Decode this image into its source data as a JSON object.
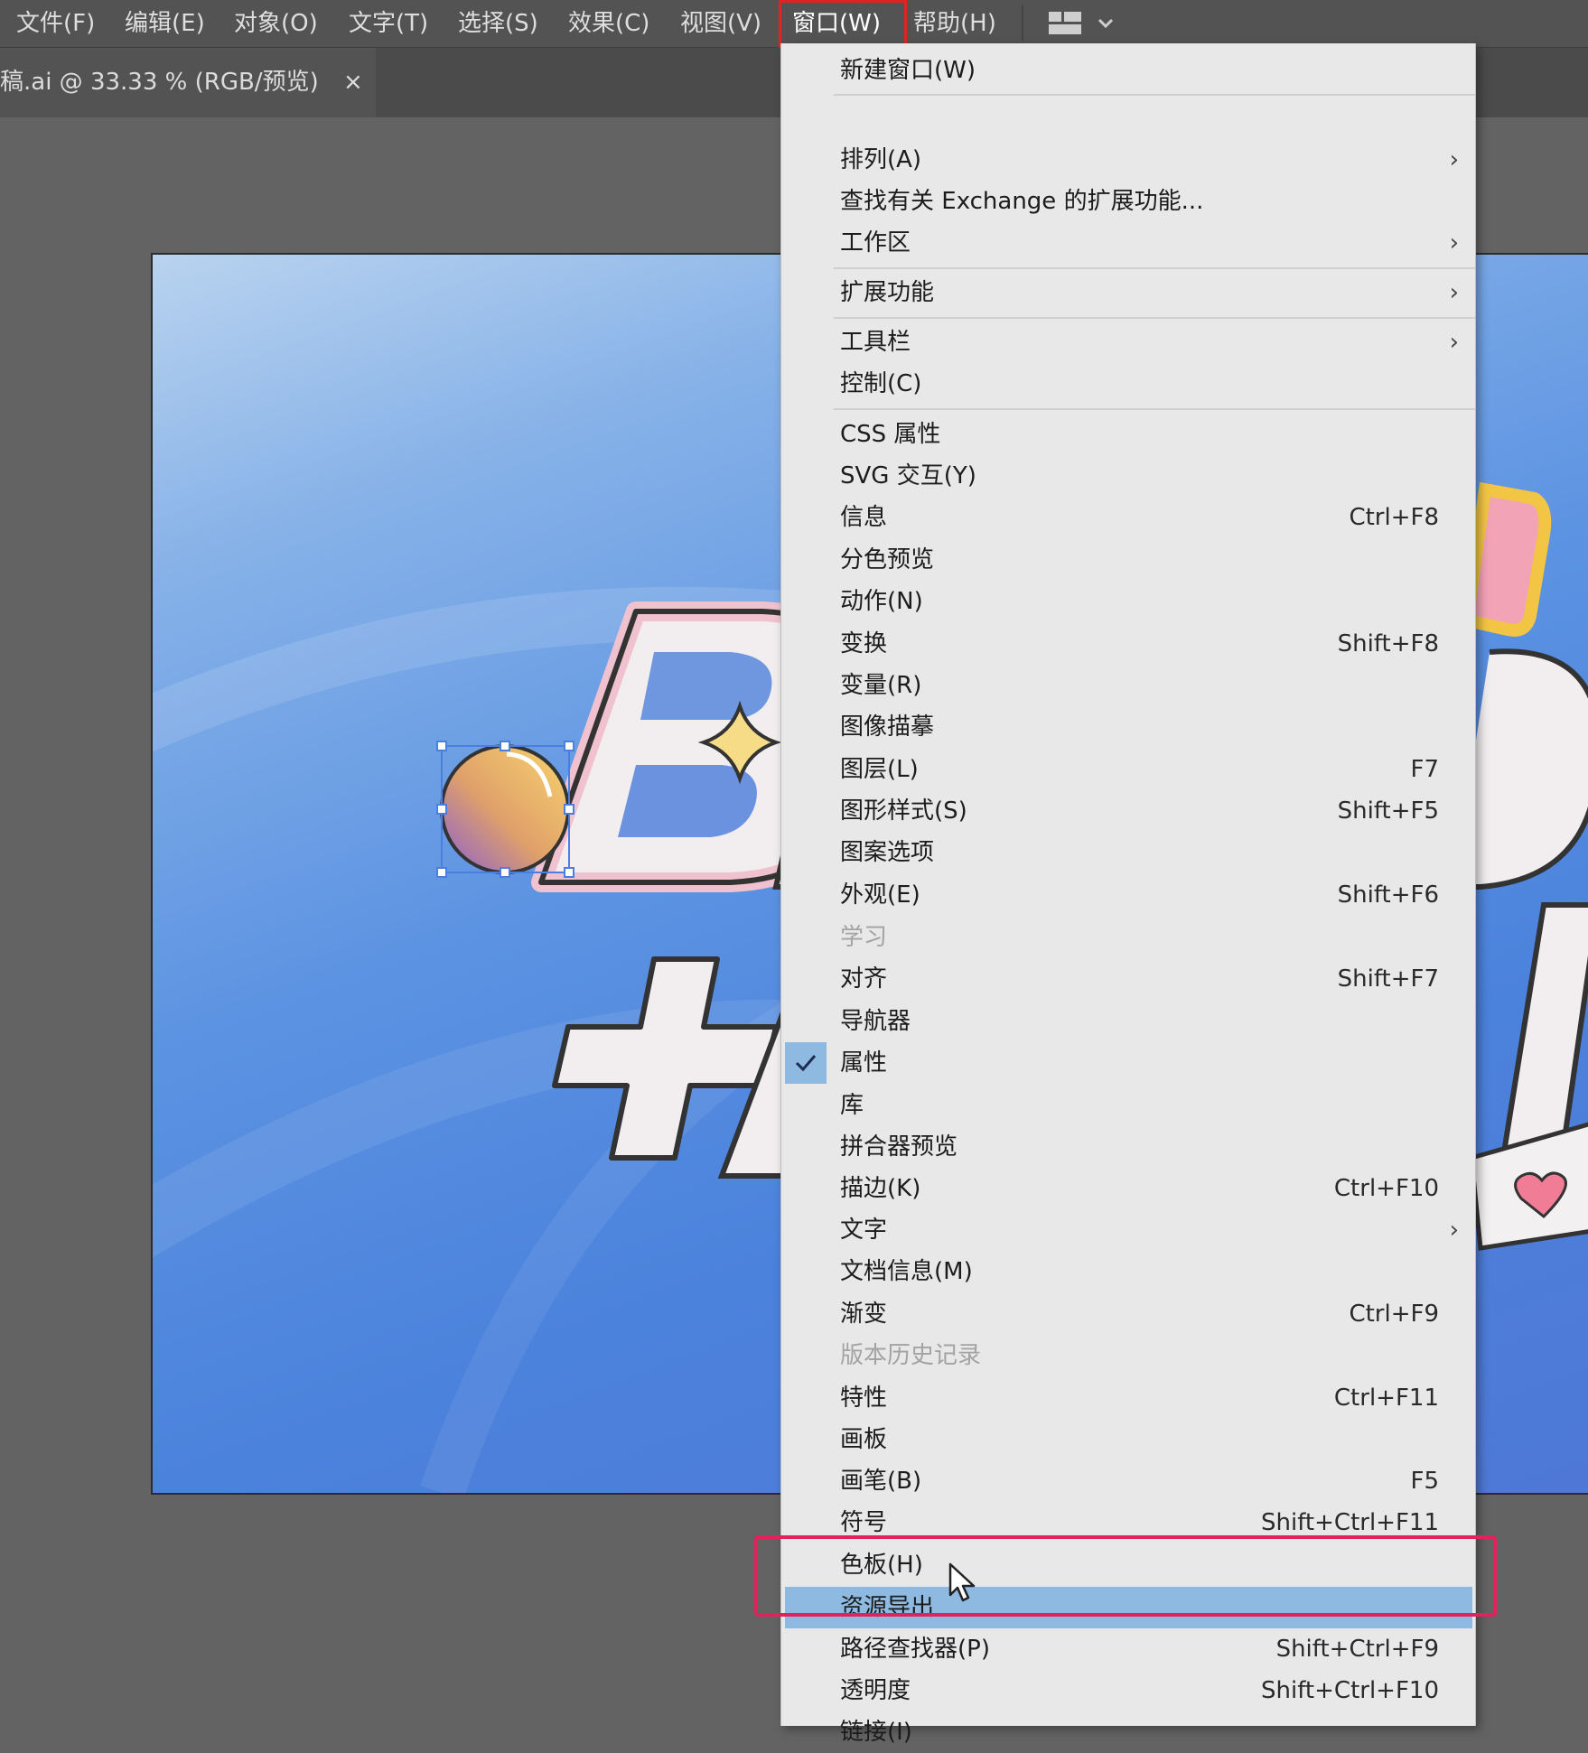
{
  "menubar": {
    "items": [
      "文件(F)",
      "编辑(E)",
      "对象(O)",
      "文字(T)",
      "选择(S)",
      "效果(C)",
      "视图(V)",
      "窗口(W)",
      "帮助(H)"
    ],
    "active_index": 7
  },
  "tab": {
    "title": "稿.ai @ 33.33 % (RGB/预览)",
    "close": "×"
  },
  "menu": {
    "items": [
      {
        "label": "新建窗口(W)"
      },
      {
        "label": "排列(A)",
        "submenu": true
      },
      {
        "label": "查找有关 Exchange 的扩展功能..."
      },
      {
        "label": "工作区",
        "submenu": true
      },
      {
        "label": "扩展功能",
        "submenu": true
      },
      {
        "label": "工具栏",
        "submenu": true
      },
      {
        "label": "控制(C)"
      },
      {
        "label": "CSS 属性"
      },
      {
        "label": "SVG 交互(Y)"
      },
      {
        "label": "信息",
        "shortcut": "Ctrl+F8"
      },
      {
        "label": "分色预览"
      },
      {
        "label": "动作(N)"
      },
      {
        "label": "变换",
        "shortcut": "Shift+F8"
      },
      {
        "label": "变量(R)"
      },
      {
        "label": "图像描摹"
      },
      {
        "label": "图层(L)",
        "shortcut": "F7"
      },
      {
        "label": "图形样式(S)",
        "shortcut": "Shift+F5"
      },
      {
        "label": "图案选项"
      },
      {
        "label": "外观(E)",
        "shortcut": "Shift+F6"
      },
      {
        "label": "学习",
        "disabled": true
      },
      {
        "label": "对齐",
        "shortcut": "Shift+F7"
      },
      {
        "label": "导航器"
      },
      {
        "label": "属性",
        "checked": true
      },
      {
        "label": "库"
      },
      {
        "label": "拼合器预览"
      },
      {
        "label": "描边(K)",
        "shortcut": "Ctrl+F10"
      },
      {
        "label": "文字",
        "submenu": true
      },
      {
        "label": "文档信息(M)"
      },
      {
        "label": "渐变",
        "shortcut": "Ctrl+F9"
      },
      {
        "label": "版本历史记录",
        "disabled": true
      },
      {
        "label": "特性",
        "shortcut": "Ctrl+F11"
      },
      {
        "label": "画板"
      },
      {
        "label": "画笔(B)",
        "shortcut": "F5"
      },
      {
        "label": "符号",
        "shortcut": "Shift+Ctrl+F11"
      },
      {
        "label": "色板(H)"
      },
      {
        "label": "资源导出",
        "selected": true
      },
      {
        "label": "路径查找器(P)",
        "shortcut": "Shift+Ctrl+F9"
      },
      {
        "label": "透明度",
        "shortcut": "Shift+Ctrl+F10"
      },
      {
        "label": "链接(I)"
      }
    ],
    "submenu_arrow": "›",
    "check_glyph": "✓"
  },
  "colors": {
    "menu_highlight": "#8ebae2",
    "annotation_red": "#e32222",
    "annotation_pink": "#e0225d"
  }
}
